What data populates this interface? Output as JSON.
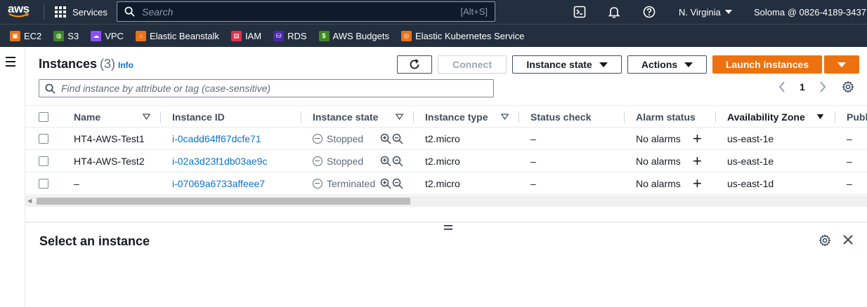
{
  "topnav": {
    "logo_text": "aws",
    "services_label": "Services",
    "search_placeholder": "Search",
    "search_shortcut": "[Alt+S]",
    "region": "N. Virginia",
    "account": "Soloma @ 0826-4189-3437"
  },
  "favorites": [
    {
      "label": "EC2",
      "color": "#e8731a"
    },
    {
      "label": "S3",
      "color": "#3f8624"
    },
    {
      "label": "VPC",
      "color": "#8c4fff"
    },
    {
      "label": "Elastic Beanstalk",
      "color": "#e8731a"
    },
    {
      "label": "IAM",
      "color": "#dd344c"
    },
    {
      "label": "RDS",
      "color": "#4d27aa"
    },
    {
      "label": "AWS Budgets",
      "color": "#3f8624"
    },
    {
      "label": "Elastic Kubernetes Service",
      "color": "#e8731a"
    }
  ],
  "header": {
    "title": "Instances",
    "count": "(3)",
    "info": "Info",
    "connect_label": "Connect",
    "instance_state_label": "Instance state",
    "actions_label": "Actions",
    "launch_label": "Launch instances"
  },
  "filter": {
    "placeholder": "Find instance by attribute or tag (case-sensitive)"
  },
  "pager": {
    "page": "1"
  },
  "table": {
    "columns": {
      "name": "Name",
      "instance_id": "Instance ID",
      "instance_state": "Instance state",
      "instance_type": "Instance type",
      "status_check": "Status check",
      "alarm_status": "Alarm status",
      "availability_zone": "Availability Zone",
      "public": "Publi"
    },
    "rows": [
      {
        "name": "HT4-AWS-Test1",
        "instance_id": "i-0cadd64ff67dcfe71",
        "state": "Stopped",
        "type": "t2.micro",
        "status_check": "–",
        "alarm": "No alarms",
        "az": "us-east-1e",
        "public": "–"
      },
      {
        "name": "HT4-AWS-Test2",
        "instance_id": "i-02a3d23f1db03ae9c",
        "state": "Stopped",
        "type": "t2.micro",
        "status_check": "–",
        "alarm": "No alarms",
        "az": "us-east-1e",
        "public": "–"
      },
      {
        "name": "–",
        "instance_id": "i-07069a6733affeee7",
        "state": "Terminated",
        "type": "t2.micro",
        "status_check": "–",
        "alarm": "No alarms",
        "az": "us-east-1d",
        "public": "–"
      }
    ]
  },
  "split_panel": {
    "title": "Select an instance"
  },
  "colors": {
    "nav_bg": "#232f3e",
    "primary": "#ec7211",
    "link": "#0972d3"
  }
}
